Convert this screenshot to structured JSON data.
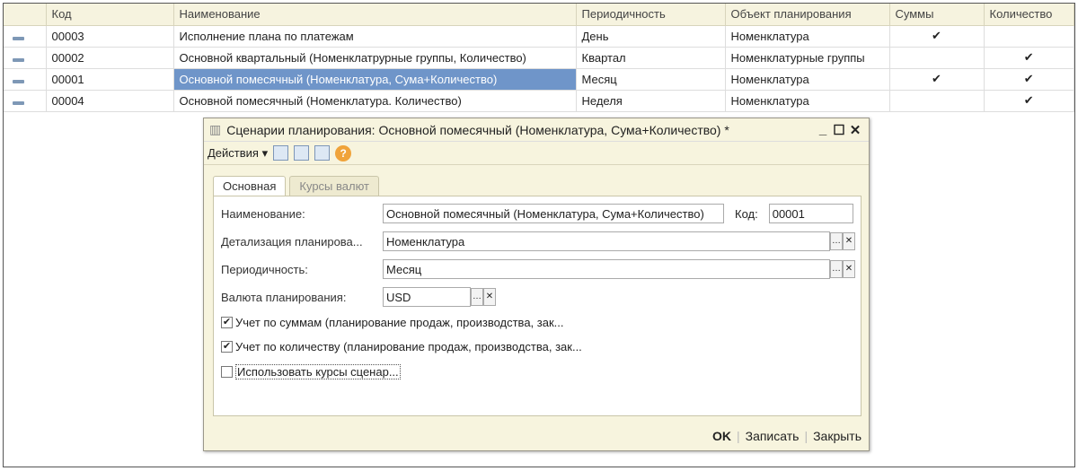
{
  "table": {
    "headers": [
      "",
      "Код",
      "Наименование",
      "Периодичность",
      "Объект планирования",
      "Суммы",
      "Количество"
    ],
    "rows": [
      {
        "code": "00003",
        "name": "Исполнение плана по платежам",
        "period": "День",
        "object": "Номенклатура",
        "sums": "✔",
        "qty": ""
      },
      {
        "code": "00002",
        "name": "Основной квартальный (Номенклатрурные группы, Количество)",
        "period": "Квартал",
        "object": "Номенклатурные группы",
        "sums": "",
        "qty": "✔"
      },
      {
        "code": "00001",
        "name": "Основной помесячный (Номенклатура, Сума+Количество)",
        "period": "Месяц",
        "object": "Номенклатура",
        "sums": "✔",
        "qty": "✔"
      },
      {
        "code": "00004",
        "name": "Основной помесячный (Номенклатура. Количество)",
        "period": "Неделя",
        "object": "Номенклатура",
        "sums": "",
        "qty": "✔"
      }
    ]
  },
  "dialog": {
    "title": "Сценарии планирования: Основной помесячный (Номенклатура, Сума+Количество) *",
    "actions": "Действия ▾",
    "help": "?",
    "tabs": [
      "Основная",
      "Курсы валют"
    ],
    "name_label": "Наименование:",
    "name_value": "Основной помесячный (Номенклатура, Сума+Количество)",
    "code_label": "Код:",
    "code_value": "00001",
    "detail_label": "Детализация планирова...",
    "detail_value": "Номенклатура",
    "period_label": "Периодичность:",
    "period_value": "Месяц",
    "currency_label": "Валюта планирования:",
    "currency_value": "USD",
    "cb1": "Учет по суммам (планирование продаж, производства, зак...",
    "cb2": "Учет по количеству (планирование продаж, производства, зак...",
    "cb3": "Использовать курсы сценар...",
    "ok": "OK",
    "save": "Записать",
    "close": "Закрыть",
    "sep": "|"
  }
}
